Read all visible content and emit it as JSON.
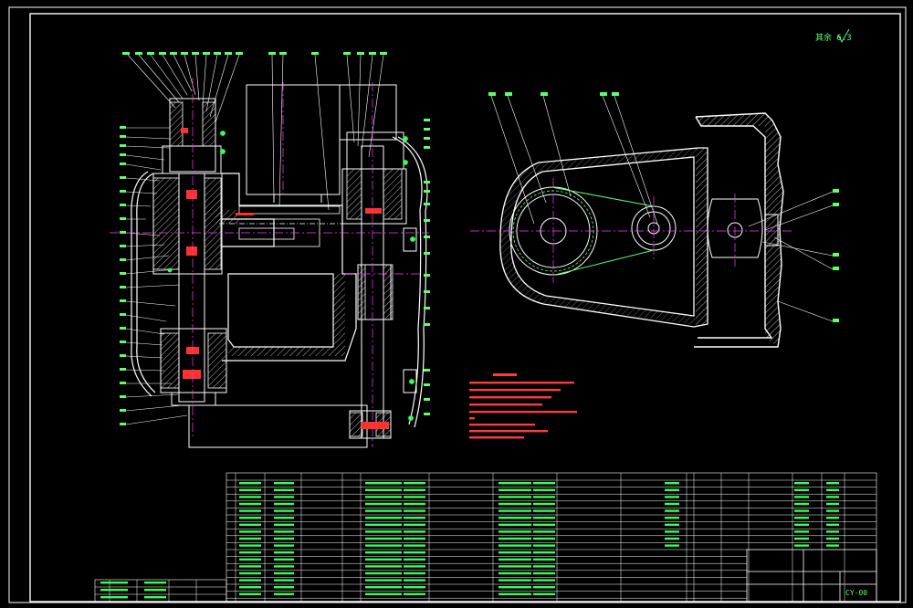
{
  "drawing": {
    "border_color": "#ffffff",
    "geometry_color": "#ffffff",
    "dimension_color": "#33ff55",
    "annotation_color": "#ff3333",
    "centerline_color": "#ff3cff",
    "hatch_color": "#ffffff"
  },
  "roughness_mark": "其余 6.3",
  "title_block": {
    "drawing_no": "CY-00"
  },
  "views": [
    "main-section-view",
    "belt-drive-side-view"
  ]
}
